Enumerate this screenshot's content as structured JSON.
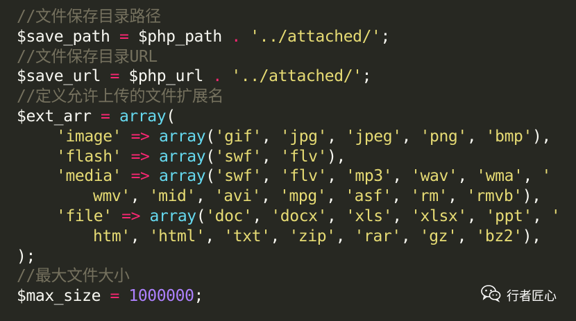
{
  "code": {
    "comment_save_path": "//文件保存目录路径",
    "save_path_var": "$save_path",
    "eq": "=",
    "php_path_var": "$php_path",
    "concat": ".",
    "attached_str": "'../attached/'",
    "semicolon": ";",
    "comment_save_url": "//文件保存目录URL",
    "save_url_var": "$save_url",
    "php_url_var": "$php_url",
    "comment_ext": "//定义允许上传的文件扩展名",
    "ext_arr_var": "$ext_arr",
    "array_fn": "array",
    "open_paren": "(",
    "arrow": "=>",
    "comma_sp": ", ",
    "close_paren_comma": "),",
    "close_block": ");",
    "image_line": {
      "key": "'image'",
      "items": [
        "'gif'",
        "'jpg'",
        "'jpeg'",
        "'png'",
        "'bmp'"
      ]
    },
    "flash_line": {
      "key": "'flash'",
      "items": [
        "'swf'",
        "'flv'"
      ]
    },
    "media_line": {
      "key": "'media'",
      "items_a": [
        "'swf'",
        "'flv'",
        "'mp3'",
        "'wav'",
        "'wma'"
      ],
      "tail_a": "'",
      "head_b": "wmv'",
      "items_b": [
        "'mid'",
        "'avi'",
        "'mpg'",
        "'asf'",
        "'rm'",
        "'rmvb'"
      ]
    },
    "file_line": {
      "key": "'file'",
      "items_a": [
        "'doc'",
        "'docx'",
        "'xls'",
        "'xlsx'",
        "'ppt'"
      ],
      "tail_a": "'",
      "head_b": "htm'",
      "items_b": [
        "'html'",
        "'txt'",
        "'zip'",
        "'rar'",
        "'gz'",
        "'bz2'"
      ]
    },
    "comment_max": "//最大文件大小",
    "max_size_var": "$max_size",
    "max_size_value": "1000000"
  },
  "watermark": {
    "icon": "wechat-icon",
    "text": "行者匠心"
  },
  "colors": {
    "background": "#272822",
    "comment": "#75715E",
    "keyword": "#F92672",
    "string": "#E6DB74",
    "function": "#66D9EF",
    "number": "#AE81FF",
    "text": "#F8F8F2"
  }
}
